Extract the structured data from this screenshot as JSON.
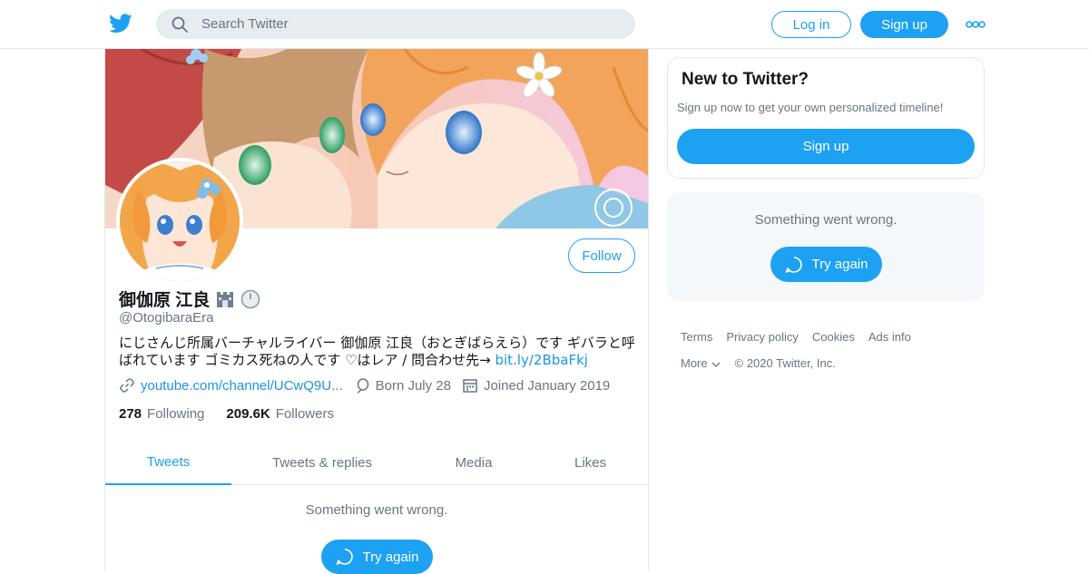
{
  "header": {
    "search_placeholder": "Search Twitter",
    "login_label": "Log in",
    "signup_label": "Sign up"
  },
  "profile": {
    "name": "御伽原 江良",
    "handle": "@OtogibaraEra",
    "follow_label": "Follow",
    "bio_text": "にじさんじ所属バーチャルライバー 御伽原 江良（おとぎばらえら）です ギバラと呼ばれています ゴミカス死ねの人です ♡はレア / 問合わせ先→ ",
    "bio_link": "bit.ly/2BbaFkj",
    "website": "youtube.com/channel/UCwQ9U...",
    "born": "Born July 28",
    "joined": "Joined January 2019",
    "following_count": "278",
    "following_label": "Following",
    "followers_count": "209.6K",
    "followers_label": "Followers"
  },
  "tabs": [
    {
      "label": "Tweets",
      "active": true
    },
    {
      "label": "Tweets & replies",
      "active": false
    },
    {
      "label": "Media",
      "active": false
    },
    {
      "label": "Likes",
      "active": false
    }
  ],
  "timeline": {
    "error_text": "Something went wrong.",
    "try_again_label": "Try again"
  },
  "sidebar": {
    "new_title": "New to Twitter?",
    "new_subtitle": "Sign up now to get your own personalized timeline!",
    "signup_label": "Sign up",
    "error_text": "Something went wrong.",
    "try_again_label": "Try again"
  },
  "footer": {
    "links": [
      "Terms",
      "Privacy policy",
      "Cookies",
      "Ads info"
    ],
    "more_label": "More",
    "copyright": "© 2020 Twitter, Inc."
  },
  "colors": {
    "accent": "#1da1f2",
    "secondary_text": "#657786",
    "link": "#1b95e0"
  }
}
